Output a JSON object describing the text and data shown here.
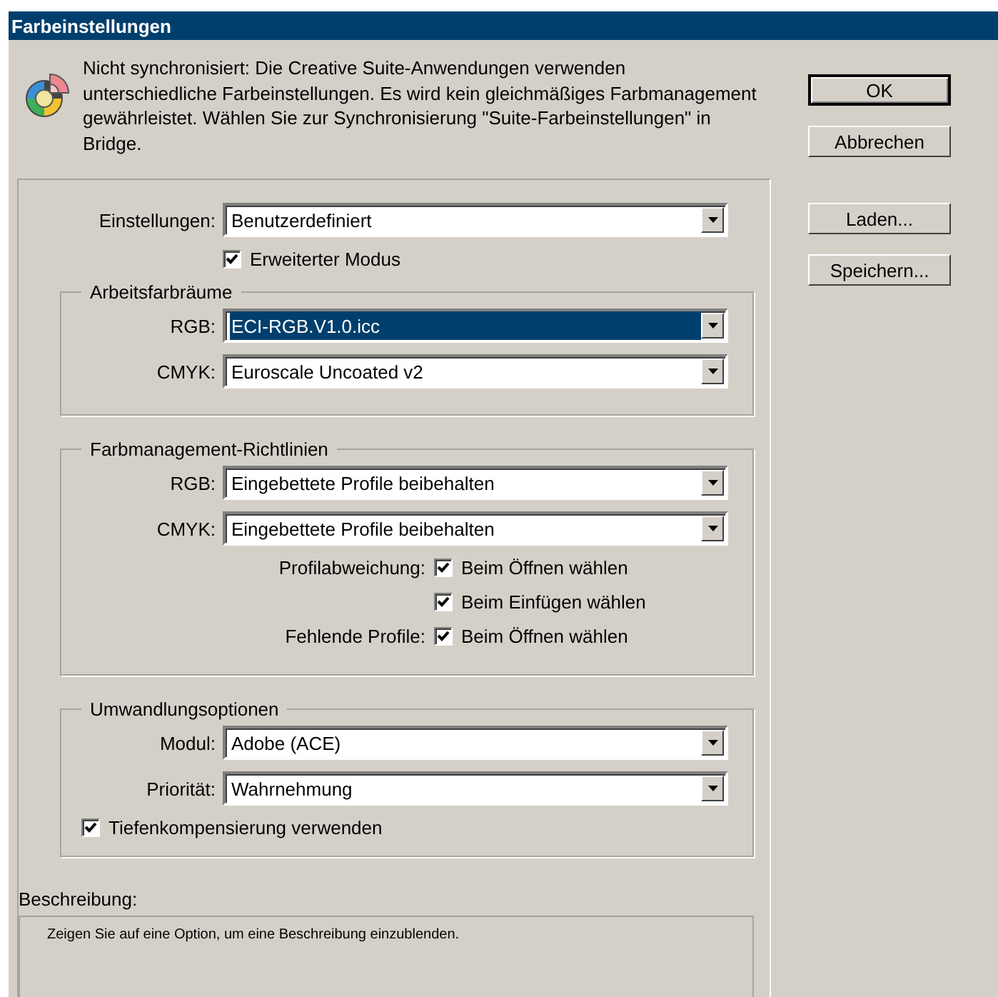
{
  "window": {
    "title": "Farbeinstellungen"
  },
  "message": "Nicht synchronisiert: Die Creative Suite-Anwendungen verwenden unterschiedliche Farbeinstellungen. Es wird kein gleichmäßiges Farbmanagement gewährleistet. Wählen Sie zur Synchronisierung \"Suite-Farbeinstellungen\" in Bridge.",
  "buttons": [
    {
      "label": "OK",
      "default": true
    },
    {
      "label": "Abbrechen",
      "default": false
    },
    {
      "label": "Laden...",
      "default": false
    },
    {
      "label": "Speichern...",
      "default": false
    }
  ],
  "settings": {
    "label": "Einstellungen:",
    "value": "Benutzerdefiniert",
    "focused": false
  },
  "advanced_mode": {
    "label": "Erweiterter Modus",
    "checked": true
  },
  "groups": [
    {
      "title": "Arbeitsfarbräume",
      "rows": [
        {
          "kind": "select",
          "label": "RGB:",
          "value": "ECI-RGB.V1.0.icc",
          "focused": true
        },
        {
          "kind": "select",
          "label": "CMYK:",
          "value": "Euroscale Uncoated v2",
          "focused": false
        }
      ]
    },
    {
      "title": "Farbmanagement-Richtlinien",
      "rows": [
        {
          "kind": "select",
          "label": "RGB:",
          "value": "Eingebettete Profile beibehalten",
          "focused": false
        },
        {
          "kind": "select",
          "label": "CMYK:",
          "value": "Eingebettete Profile beibehalten",
          "focused": false
        },
        {
          "kind": "checkbox",
          "label": "Profilabweichung:",
          "text": "Beim Öffnen wählen",
          "checked": true
        },
        {
          "kind": "checkbox",
          "text": "Beim Einfügen wählen",
          "checked": true
        },
        {
          "kind": "checkbox",
          "label": "Fehlende Profile:",
          "text": "Beim Öffnen wählen",
          "checked": true
        }
      ]
    },
    {
      "title": "Umwandlungsoptionen",
      "rows": [
        {
          "kind": "select",
          "label": "Modul:",
          "value": "Adobe (ACE)",
          "focused": false
        },
        {
          "kind": "select",
          "label": "Priorität:",
          "value": "Wahrnehmung",
          "focused": false
        },
        {
          "kind": "option",
          "text": "Tiefenkompensierung verwenden",
          "checked": true
        }
      ]
    }
  ],
  "description": {
    "label": "Beschreibung:",
    "text": "Zeigen Sie auf eine Option, um eine Beschreibung einzublenden."
  }
}
